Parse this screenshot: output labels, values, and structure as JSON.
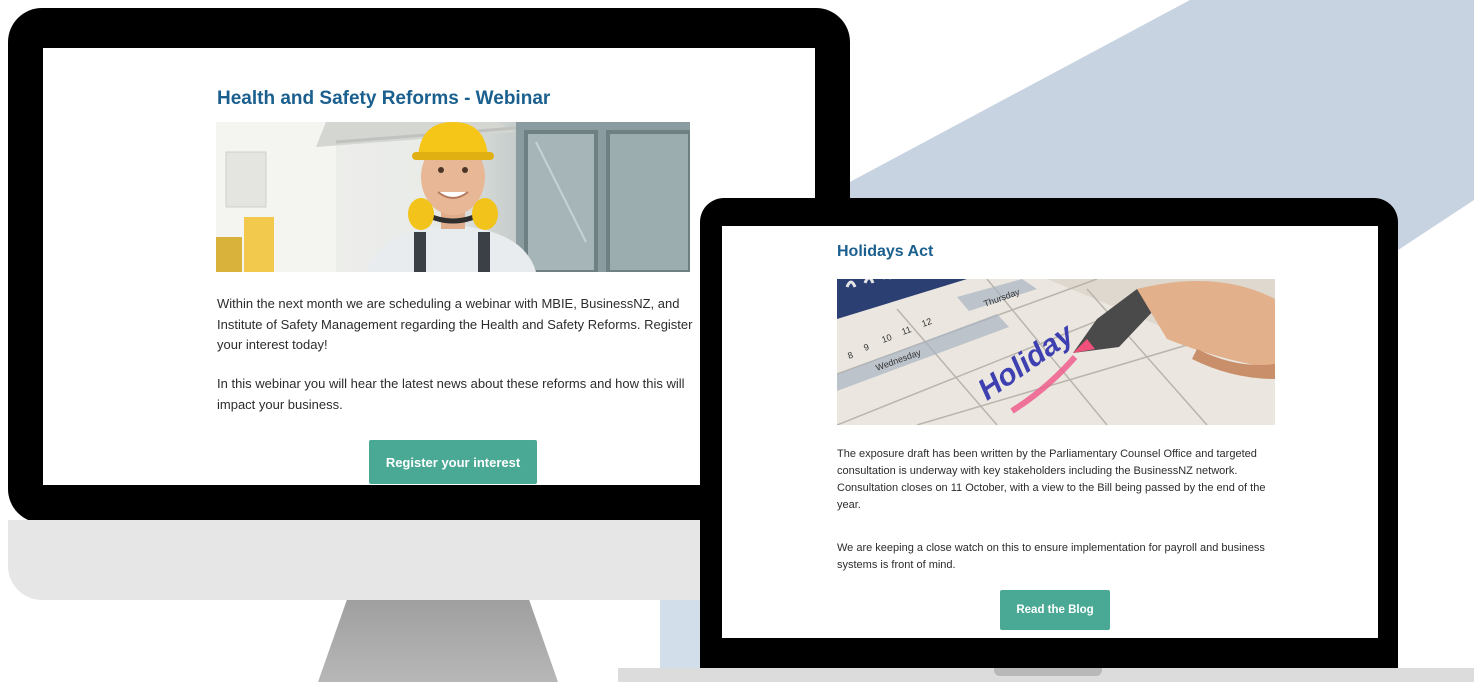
{
  "colors": {
    "title": "#1a5f8e",
    "button": "#4aa995",
    "background_shape": "#c7d3e1"
  },
  "desktop": {
    "title": "Health and Safety Reforms - Webinar",
    "hero_image": "worker-in-hard-hat-photo",
    "paragraph_1": "Within the next month we are scheduling a webinar with MBIE, BusinessNZ, and Institute of Safety Management regarding the Health and Safety Reforms. Register your interest today!",
    "paragraph_2": "In this webinar you will hear the latest news about these reforms and how this will impact your business.",
    "button_label": "Register your interest"
  },
  "laptop": {
    "title": "Holidays Act",
    "hero_image": "calendar-holiday-photo",
    "paragraph_1": "The exposure draft has been written by the Parliamentary Counsel Office and targeted consultation is underway with key stakeholders including the BusinessNZ network. Consultation closes on 11 October, with a view to the Bill being passed by the end of the year.",
    "paragraph_2": "We are keeping a close watch on this to ensure implementation for payroll and business systems is front of mind.",
    "button_label": "Read the Blog"
  }
}
